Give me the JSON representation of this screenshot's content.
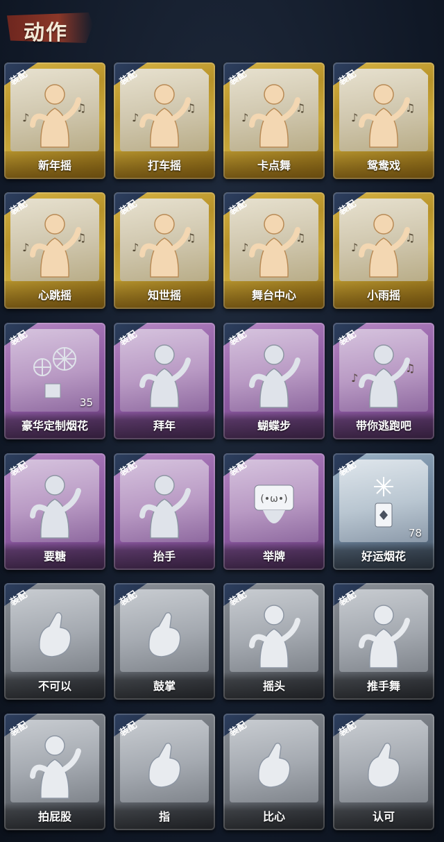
{
  "header": {
    "title": "动作"
  },
  "badge_label": "装配",
  "colors": {
    "gold": "#c9a83a",
    "purple": "#8d5aa2",
    "blue": "#6b8199",
    "gray": "#676c73",
    "badge": "#2f4161"
  },
  "cards": [
    {
      "label": "新年摇",
      "rarity": "gold",
      "icon": "figure-waving-icon"
    },
    {
      "label": "打车摇",
      "rarity": "gold",
      "icon": "figure-dancing-icon"
    },
    {
      "label": "卡点舞",
      "rarity": "gold",
      "icon": "figure-pointing-up-icon"
    },
    {
      "label": "鸳鸯戏",
      "rarity": "gold",
      "icon": "figure-dancing-icon"
    },
    {
      "label": "心跳摇",
      "rarity": "gold",
      "icon": "figure-hand-raised-icon"
    },
    {
      "label": "知世摇",
      "rarity": "gold",
      "icon": "figure-arms-out-icon"
    },
    {
      "label": "舞台中心",
      "rarity": "gold",
      "icon": "figure-center-icon"
    },
    {
      "label": "小雨摇",
      "rarity": "gold",
      "icon": "figure-swaying-icon"
    },
    {
      "label": "豪华定制烟花",
      "rarity": "purple",
      "icon": "fireworks-icon",
      "count": "35"
    },
    {
      "label": "拜年",
      "rarity": "purple",
      "icon": "figure-bowing-icon"
    },
    {
      "label": "蝴蝶步",
      "rarity": "purple",
      "icon": "figure-arms-pointing-icon"
    },
    {
      "label": "带你逃跑吧",
      "rarity": "purple",
      "icon": "figure-reaching-icon"
    },
    {
      "label": "要糖",
      "rarity": "purple",
      "icon": "figure-asking-icon"
    },
    {
      "label": "抬手",
      "rarity": "purple",
      "icon": "figure-raise-hand-icon"
    },
    {
      "label": "举牌",
      "rarity": "purple",
      "icon": "figure-holding-sign-icon"
    },
    {
      "label": "好运烟花",
      "rarity": "blue",
      "icon": "firework-canister-icon",
      "count": "78"
    },
    {
      "label": "不可以",
      "rarity": "gray",
      "icon": "finger-wag-icon"
    },
    {
      "label": "鼓掌",
      "rarity": "gray",
      "icon": "clapping-hands-icon"
    },
    {
      "label": "摇头",
      "rarity": "gray",
      "icon": "figure-head-shake-icon"
    },
    {
      "label": "推手舞",
      "rarity": "gray",
      "icon": "figure-push-dance-icon"
    },
    {
      "label": "拍屁股",
      "rarity": "gray",
      "icon": "figure-patting-icon"
    },
    {
      "label": "指",
      "rarity": "gray",
      "icon": "pointing-hand-icon"
    },
    {
      "label": "比心",
      "rarity": "gray",
      "icon": "finger-heart-icon"
    },
    {
      "label": "认可",
      "rarity": "gray",
      "icon": "thumbs-up-icon"
    }
  ]
}
